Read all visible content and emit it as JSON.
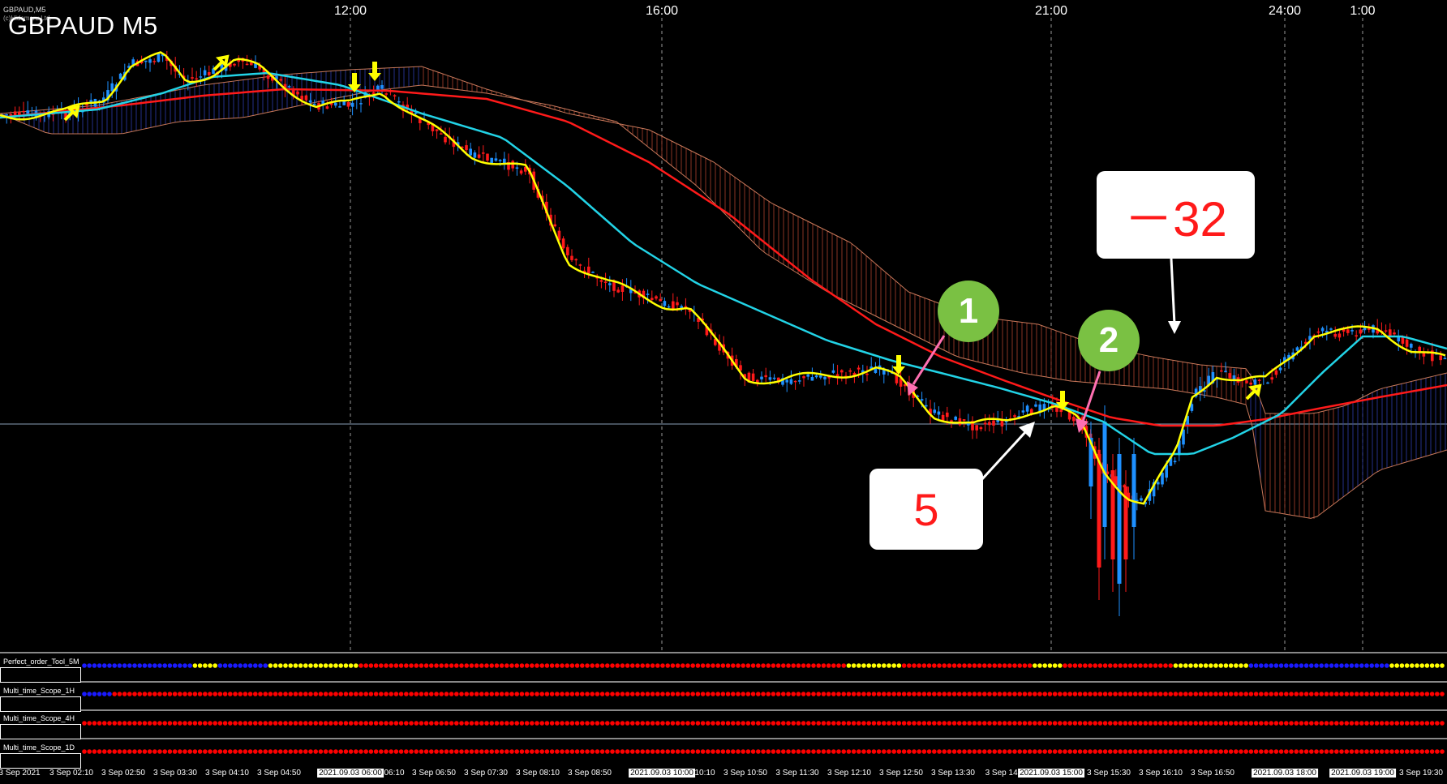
{
  "chart": {
    "symbol_title": "GBPAUD M5",
    "small_title": "GBPAUD,M5",
    "small_subtitle": "(c)Hidemaru Ltd.",
    "top_time_labels": [
      "12:00",
      "16:00",
      "21:00",
      "24:00",
      "1:00"
    ],
    "colors": {
      "background": "#000000",
      "bull_candle": "#1e90ff",
      "bear_candle": "#ff1a1a",
      "ma_fast": "#ffff00",
      "ma_mid": "#22d3e6",
      "ma_slow": "#ff1a1a",
      "cloud_outline": "#c8785a",
      "cloud_bear_hatch": "#a03d2a",
      "cloud_bull_hatch": "#2a3aa0",
      "crosshair": "#8aa0b8",
      "grid": "#cccccc"
    }
  },
  "callouts": {
    "minus32": "－32",
    "five": "5"
  },
  "badges": {
    "one": "1",
    "two": "2"
  },
  "indicators": [
    {
      "label": "Perfect_order_Tool_5M"
    },
    {
      "label": "Multi_time_Scope_1H"
    },
    {
      "label": "Multi_time_Scope_4H"
    },
    {
      "label": "Multi_time_Scope_1D"
    }
  ],
  "x_axis_labels": [
    {
      "text": "3 Sep 2021",
      "highlight": false
    },
    {
      "text": "3 Sep 02:10",
      "highlight": false
    },
    {
      "text": "3 Sep 02:50",
      "highlight": false
    },
    {
      "text": "3 Sep 03:30",
      "highlight": false
    },
    {
      "text": "3 Sep 04:10",
      "highlight": false
    },
    {
      "text": "3 Sep 04:50",
      "highlight": false
    },
    {
      "text": "2021.09.03 06:00",
      "highlight": true
    },
    {
      "text": "06:10",
      "highlight": false
    },
    {
      "text": "3 Sep 06:50",
      "highlight": false
    },
    {
      "text": "3 Sep 07:30",
      "highlight": false
    },
    {
      "text": "3 Sep 08:10",
      "highlight": false
    },
    {
      "text": "3 Sep 08:50",
      "highlight": false
    },
    {
      "text": "2021.09.03 10:00",
      "highlight": true
    },
    {
      "text": "10:10",
      "highlight": false
    },
    {
      "text": "3 Sep 10:50",
      "highlight": false
    },
    {
      "text": "3 Sep 11:30",
      "highlight": false
    },
    {
      "text": "3 Sep 12:10",
      "highlight": false
    },
    {
      "text": "3 Sep 12:50",
      "highlight": false
    },
    {
      "text": "3 Sep 13:30",
      "highlight": false
    },
    {
      "text": "3 Sep 14:",
      "highlight": false
    },
    {
      "text": "2021.09.03 15:00",
      "highlight": true
    },
    {
      "text": "3 Sep 15:30",
      "highlight": false
    },
    {
      "text": "3 Sep 16:10",
      "highlight": false
    },
    {
      "text": "3 Sep 16:50",
      "highlight": false
    },
    {
      "text": "2021.09.03 18:00",
      "highlight": true
    },
    {
      "text": "2021.09.03 19:00",
      "highlight": true
    },
    {
      "text": "3 Sep 19:30",
      "highlight": false
    }
  ]
}
